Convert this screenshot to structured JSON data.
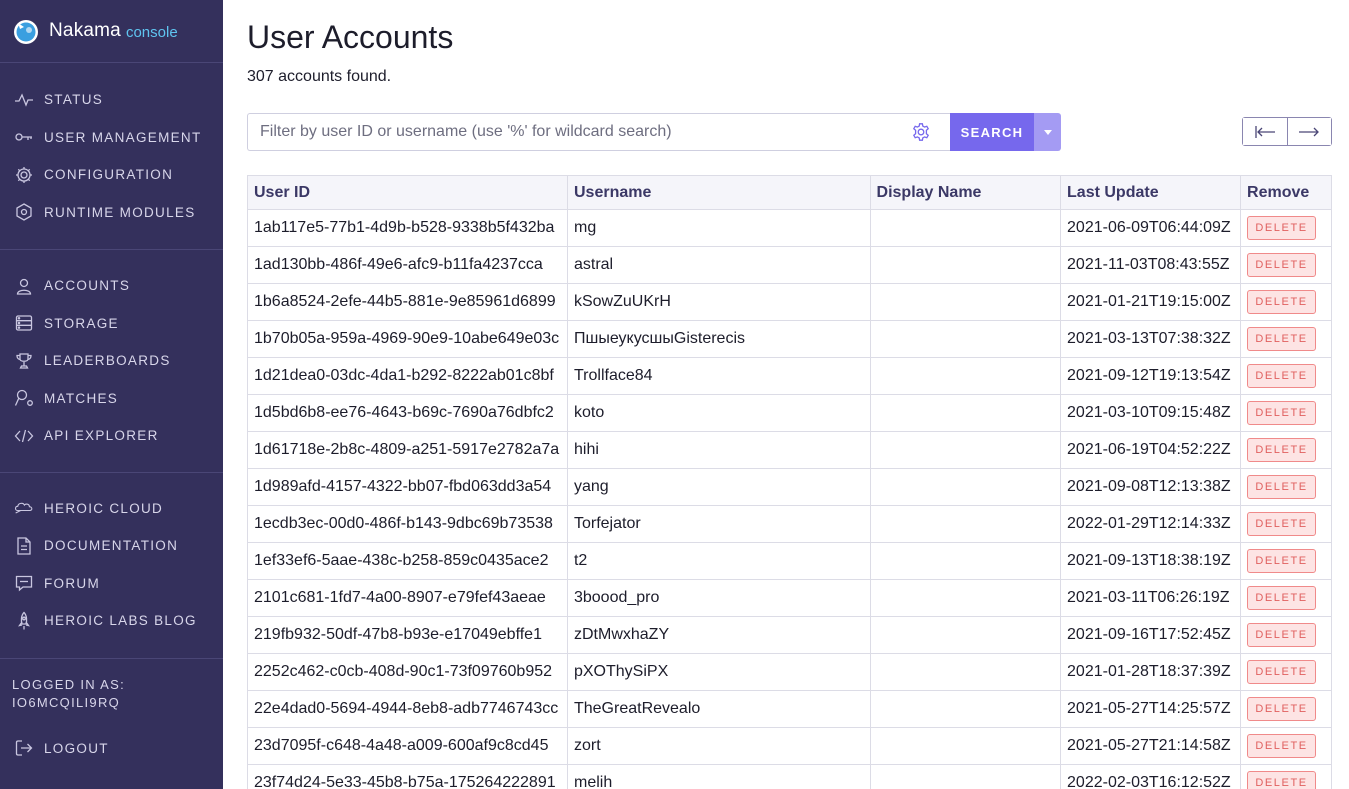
{
  "brand": {
    "name": "Nakama",
    "sub": "console"
  },
  "sidebar": {
    "group1": [
      {
        "label": "STATUS",
        "icon": "pulse-icon"
      },
      {
        "label": "USER MANAGEMENT",
        "icon": "key-icon"
      },
      {
        "label": "CONFIGURATION",
        "icon": "gear-icon"
      },
      {
        "label": "RUNTIME MODULES",
        "icon": "module-icon"
      }
    ],
    "group2": [
      {
        "label": "ACCOUNTS",
        "icon": "user-icon"
      },
      {
        "label": "STORAGE",
        "icon": "storage-icon"
      },
      {
        "label": "LEADERBOARDS",
        "icon": "trophy-icon"
      },
      {
        "label": "MATCHES",
        "icon": "matches-icon"
      },
      {
        "label": "API EXPLORER",
        "icon": "code-icon"
      }
    ],
    "group3": [
      {
        "label": "HEROIC CLOUD",
        "icon": "cloud-icon"
      },
      {
        "label": "DOCUMENTATION",
        "icon": "document-icon"
      },
      {
        "label": "FORUM",
        "icon": "chat-icon"
      },
      {
        "label": "HEROIC LABS BLOG",
        "icon": "rocket-icon"
      }
    ],
    "logged_in_label": "LOGGED IN AS:",
    "logged_in_user": "IO6MCQILI9RQ",
    "logout": "LOGOUT"
  },
  "page": {
    "title": "User Accounts",
    "count_text": "307 accounts found."
  },
  "search": {
    "placeholder": "Filter by user ID or username (use '%' for wildcard search)",
    "value": "",
    "button": "SEARCH"
  },
  "table": {
    "headers": [
      "User ID",
      "Username",
      "Display Name",
      "Last Update",
      "Remove"
    ],
    "delete_label": "DELETE",
    "rows": [
      {
        "id": "1ab117e5-77b1-4d9b-b528-9338b5f432ba",
        "username": "mg",
        "display": "",
        "updated": "2021-06-09T06:44:09Z"
      },
      {
        "id": "1ad130bb-486f-49e6-afc9-b11fa4237cca",
        "username": "astral",
        "display": "",
        "updated": "2021-11-03T08:43:55Z"
      },
      {
        "id": "1b6a8524-2efe-44b5-881e-9e85961d6899",
        "username": "kSowZuUKrH",
        "display": "",
        "updated": "2021-01-21T19:15:00Z"
      },
      {
        "id": "1b70b05a-959a-4969-90e9-10abe649e03c",
        "username": "ПшыеукусшыGisterecis",
        "display": "",
        "updated": "2021-03-13T07:38:32Z"
      },
      {
        "id": "1d21dea0-03dc-4da1-b292-8222ab01c8bf",
        "username": "Trollface84",
        "display": "",
        "updated": "2021-09-12T19:13:54Z"
      },
      {
        "id": "1d5bd6b8-ee76-4643-b69c-7690a76dbfc2",
        "username": "koto",
        "display": "",
        "updated": "2021-03-10T09:15:48Z"
      },
      {
        "id": "1d61718e-2b8c-4809-a251-5917e2782a7a",
        "username": "hihi",
        "display": "",
        "updated": "2021-06-19T04:52:22Z"
      },
      {
        "id": "1d989afd-4157-4322-bb07-fbd063dd3a54",
        "username": "yang",
        "display": "",
        "updated": "2021-09-08T12:13:38Z"
      },
      {
        "id": "1ecdb3ec-00d0-486f-b143-9dbc69b73538",
        "username": "Torfejator",
        "display": "",
        "updated": "2022-01-29T12:14:33Z"
      },
      {
        "id": "1ef33ef6-5aae-438c-b258-859c0435ace2",
        "username": "t2",
        "display": "",
        "updated": "2021-09-13T18:38:19Z"
      },
      {
        "id": "2101c681-1fd7-4a00-8907-e79fef43aeae",
        "username": "3boood_pro",
        "display": "",
        "updated": "2021-03-11T06:26:19Z"
      },
      {
        "id": "219fb932-50df-47b8-b93e-e17049ebffe1",
        "username": "zDtMwxhaZY",
        "display": "",
        "updated": "2021-09-16T17:52:45Z"
      },
      {
        "id": "2252c462-c0cb-408d-90c1-73f09760b952",
        "username": "pXOThySiPX",
        "display": "",
        "updated": "2021-01-28T18:37:39Z"
      },
      {
        "id": "22e4dad0-5694-4944-8eb8-adb7746743cc",
        "username": "TheGreatRevealo",
        "display": "",
        "updated": "2021-05-27T14:25:57Z"
      },
      {
        "id": "23d7095f-c648-4a48-a009-600af9c8cd45",
        "username": "zort",
        "display": "",
        "updated": "2021-05-27T21:14:58Z"
      },
      {
        "id": "23f74d24-5e33-45b8-b75a-175264222891",
        "username": "melih",
        "display": "",
        "updated": "2022-02-03T16:12:52Z"
      }
    ]
  },
  "colors": {
    "sidebar": "#34305c",
    "accent": "#7668ed",
    "accent_light": "#a49bf3",
    "link": "#5fc4f0",
    "danger": "#e0605f"
  }
}
